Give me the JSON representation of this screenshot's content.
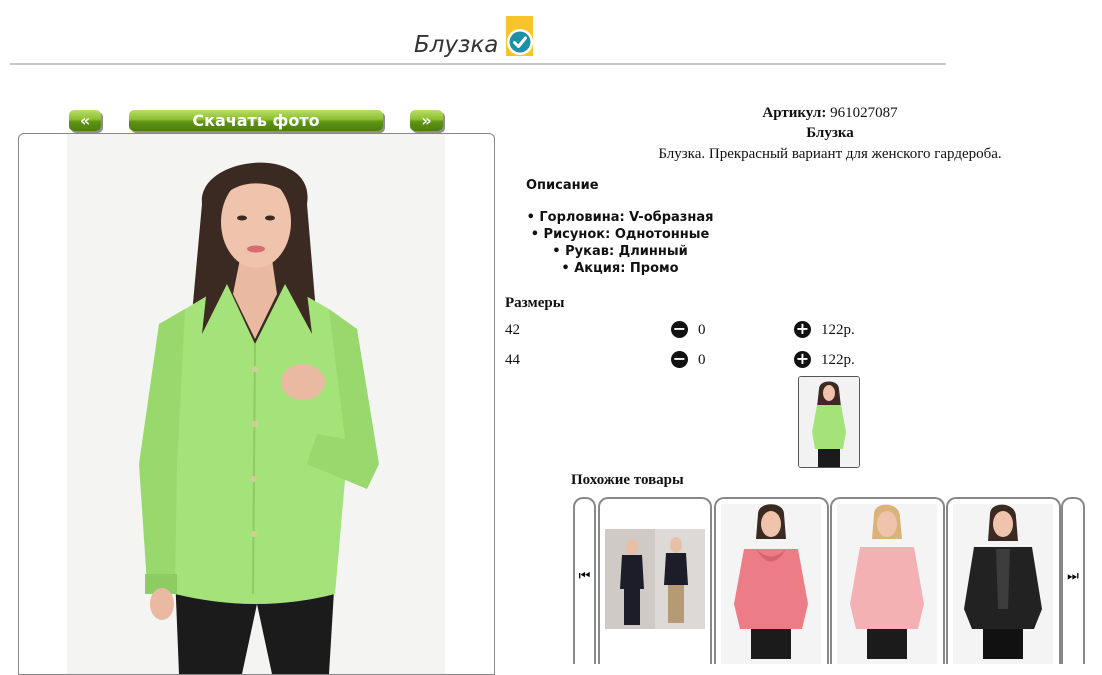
{
  "title": "Блузка",
  "buttons": {
    "prev": "«",
    "download": "Скачать фото",
    "next": "»"
  },
  "product": {
    "article_label": "Артикул:",
    "article_value": "961027087",
    "name": "Блузка",
    "description": "Блузка. Прекрасный вариант для женского гардероба."
  },
  "description_section": {
    "heading": "Описание",
    "attributes": [
      "• Горловина: V-образная",
      "• Рисунок: Однотонные",
      "• Рукав: Длинный",
      "• Акция: Промо"
    ]
  },
  "sizes": {
    "heading": "Размеры",
    "rows": [
      {
        "size": "42",
        "qty": "0",
        "price": "122р."
      },
      {
        "size": "44",
        "qty": "0",
        "price": "122р."
      }
    ]
  },
  "similar": {
    "heading": "Похожие товары",
    "prev_icon": "⏮",
    "next_icon": "⏭"
  },
  "colors": {
    "button_green": "#6fa81f",
    "badge_yellow": "#f7c42b",
    "badge_check": "#1f8fa6",
    "blouse_green": "#a4e27a"
  }
}
